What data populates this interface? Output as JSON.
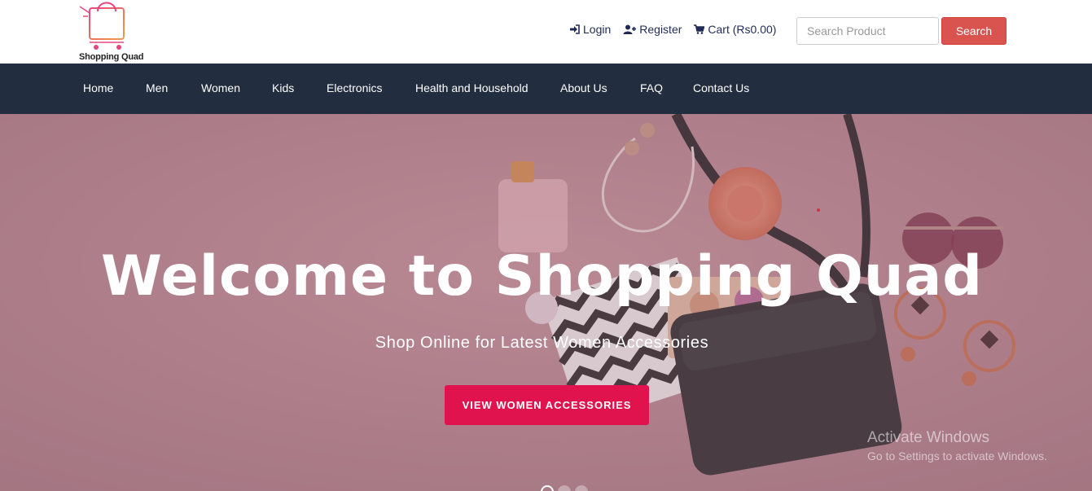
{
  "brand": {
    "name": "Shopping Quad"
  },
  "header": {
    "links": [
      {
        "label": "Login",
        "icon": "sign-in-icon"
      },
      {
        "label": "Register",
        "icon": "user-plus-icon"
      },
      {
        "label": "Cart (Rs0.00)",
        "icon": "cart-icon"
      }
    ],
    "search": {
      "placeholder": "Search Product",
      "button_label": "Search"
    }
  },
  "nav": {
    "items": [
      "Home",
      "Men",
      "Women",
      "Kids",
      "Electronics",
      "Health and Household",
      "About Us",
      "FAQ",
      "Contact Us"
    ]
  },
  "hero": {
    "title": "Welcome to Shopping Quad",
    "subtitle": "Shop Online for Latest Women Accessories",
    "cta_label": "VIEW WOMEN ACCESSORIES",
    "slides_count": 3,
    "active_slide": 1
  },
  "watermark": {
    "title": "Activate Windows",
    "subtitle": "Go to Settings to activate Windows."
  },
  "colors": {
    "nav_bg": "#222d3f",
    "search_button": "#d9534f",
    "cta_button": "#e0134f",
    "hero_bg": "#b0838f"
  }
}
